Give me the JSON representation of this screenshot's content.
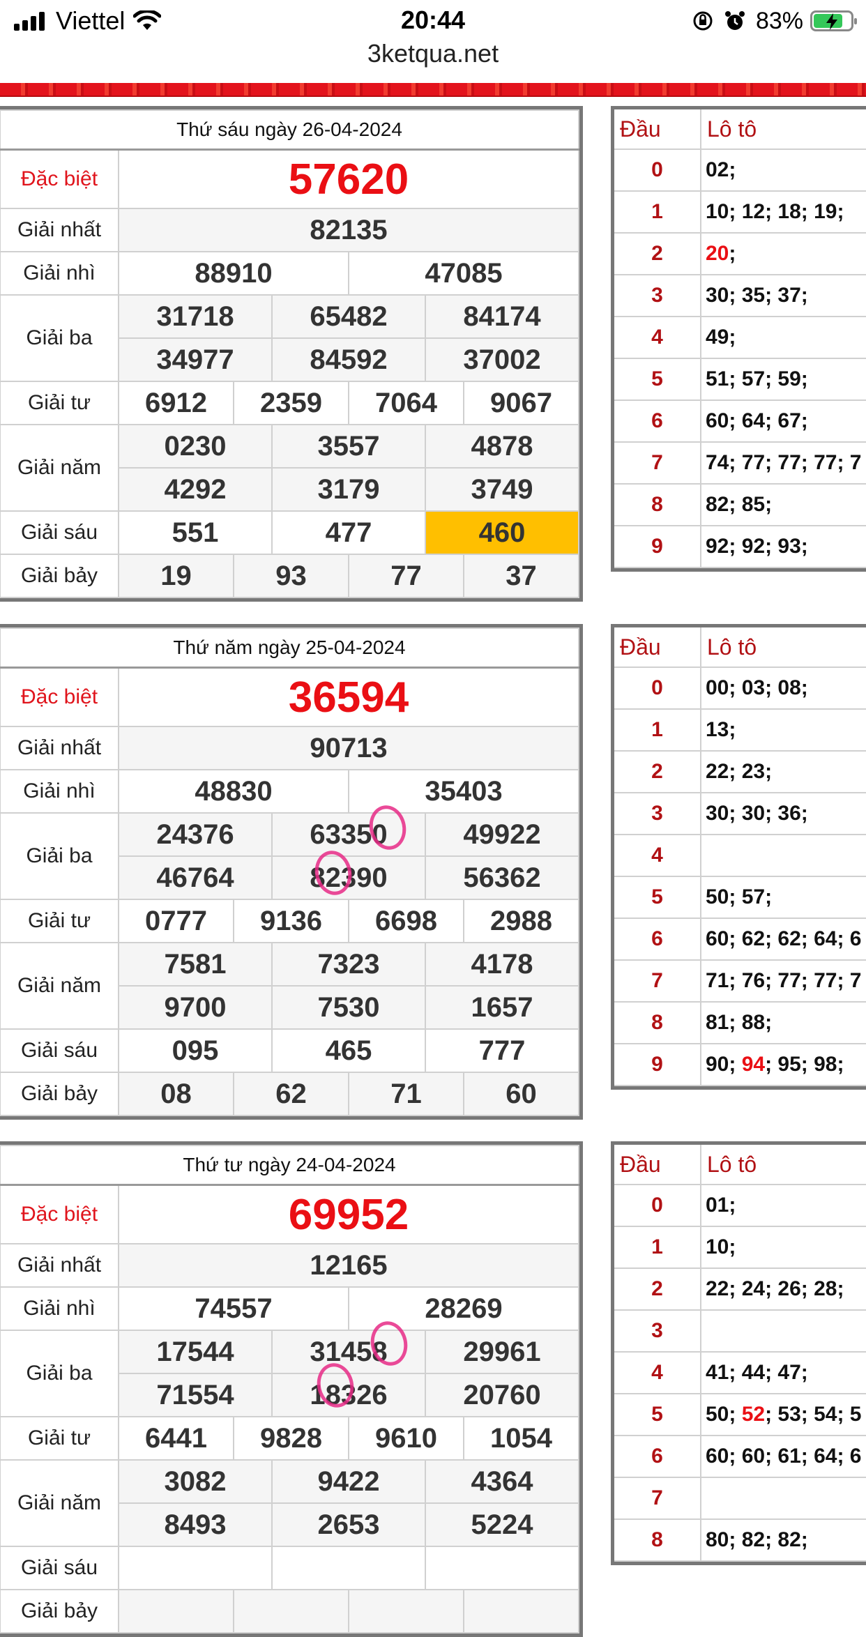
{
  "status": {
    "carrier": "Viettel",
    "time": "20:44",
    "battery": "83%",
    "icons": [
      "signal-icon",
      "wifi-icon",
      "orientation-lock-icon",
      "alarm-icon",
      "battery-charging-icon"
    ]
  },
  "url": "3ketqua.net",
  "days": [
    {
      "date": "Thứ sáu ngày 26-04-2024",
      "labels": {
        "db": "Đặc biệt",
        "g1": "Giải nhất",
        "g2": "Giải nhì",
        "g3": "Giải ba",
        "g4": "Giải tư",
        "g5": "Giải năm",
        "g6": "Giải sáu",
        "g7": "Giải bảy"
      },
      "db": "57620",
      "g1": "82135",
      "g2": [
        "88910",
        "47085"
      ],
      "g3": [
        "31718",
        "65482",
        "84174",
        "34977",
        "84592",
        "37002"
      ],
      "g4": [
        "6912",
        "2359",
        "7064",
        "9067"
      ],
      "g5": [
        "0230",
        "3557",
        "4878",
        "4292",
        "3179",
        "3749"
      ],
      "g6": [
        "551",
        "477",
        "460"
      ],
      "g7": [
        "19",
        "93",
        "77",
        "37"
      ],
      "loto_head": {
        "dau": "Đầu",
        "loto": "Lô tô"
      },
      "loto": [
        {
          "d": "0",
          "pre": "02;",
          "red": "",
          "post": ""
        },
        {
          "d": "1",
          "pre": "10; 12; 18; 19;",
          "red": "",
          "post": ""
        },
        {
          "d": "2",
          "pre": "",
          "red": "20",
          "post": ";"
        },
        {
          "d": "3",
          "pre": "30; 35; 37;",
          "red": "",
          "post": ""
        },
        {
          "d": "4",
          "pre": "49;",
          "red": "",
          "post": ""
        },
        {
          "d": "5",
          "pre": "51; 57; 59;",
          "red": "",
          "post": ""
        },
        {
          "d": "6",
          "pre": "60; 64; 67;",
          "red": "",
          "post": ""
        },
        {
          "d": "7",
          "pre": "74; 77; 77; 77; 7",
          "red": "",
          "post": ""
        },
        {
          "d": "8",
          "pre": "82; 85;",
          "red": "",
          "post": ""
        },
        {
          "d": "9",
          "pre": "92; 92; 93;",
          "red": "",
          "post": ""
        }
      ]
    },
    {
      "date": "Thứ năm ngày 25-04-2024",
      "labels": {
        "db": "Đặc biệt",
        "g1": "Giải nhất",
        "g2": "Giải nhì",
        "g3": "Giải ba",
        "g4": "Giải tư",
        "g5": "Giải năm",
        "g6": "Giải sáu",
        "g7": "Giải bảy"
      },
      "db": "36594",
      "g1": "90713",
      "g2": [
        "48830",
        "35403"
      ],
      "g3": [
        "24376",
        "63350",
        "49922",
        "46764",
        "82390",
        "56362"
      ],
      "g4": [
        "0777",
        "9136",
        "6698",
        "2988"
      ],
      "g5": [
        "7581",
        "7323",
        "4178",
        "9700",
        "7530",
        "1657"
      ],
      "g6": [
        "095",
        "465",
        "777"
      ],
      "g7": [
        "08",
        "62",
        "71",
        "60"
      ],
      "loto_head": {
        "dau": "Đầu",
        "loto": "Lô tô"
      },
      "loto": [
        {
          "d": "0",
          "pre": "00; 03; 08;",
          "red": "",
          "post": ""
        },
        {
          "d": "1",
          "pre": "13;",
          "red": "",
          "post": ""
        },
        {
          "d": "2",
          "pre": "22; 23;",
          "red": "",
          "post": ""
        },
        {
          "d": "3",
          "pre": "30; 30; 36;",
          "red": "",
          "post": ""
        },
        {
          "d": "4",
          "pre": "",
          "red": "",
          "post": ""
        },
        {
          "d": "5",
          "pre": "50; 57;",
          "red": "",
          "post": ""
        },
        {
          "d": "6",
          "pre": "60; 62; 62; 64; 6",
          "red": "",
          "post": ""
        },
        {
          "d": "7",
          "pre": "71; 76; 77; 77; 7",
          "red": "",
          "post": ""
        },
        {
          "d": "8",
          "pre": "81; 88;",
          "red": "",
          "post": ""
        },
        {
          "d": "9",
          "pre": "90; ",
          "red": "94",
          "post": "; 95; 98;"
        }
      ]
    },
    {
      "date": "Thứ tư ngày 24-04-2024",
      "labels": {
        "db": "Đặc biệt",
        "g1": "Giải nhất",
        "g2": "Giải nhì",
        "g3": "Giải ba",
        "g4": "Giải tư",
        "g5": "Giải năm",
        "g6": "Giải sáu",
        "g7": "Giải bảy"
      },
      "db": "69952",
      "g1": "12165",
      "g2": [
        "74557",
        "28269"
      ],
      "g3": [
        "17544",
        "31458",
        "29961",
        "71554",
        "18326",
        "20760"
      ],
      "g4": [
        "6441",
        "9828",
        "9610",
        "1054"
      ],
      "g5": [
        "3082",
        "9422",
        "4364",
        "8493",
        "2653",
        "5224"
      ],
      "g6": [
        "",
        "",
        ""
      ],
      "g7": [
        "",
        "",
        "",
        ""
      ],
      "loto_head": {
        "dau": "Đầu",
        "loto": "Lô tô"
      },
      "loto": [
        {
          "d": "0",
          "pre": "01;",
          "red": "",
          "post": ""
        },
        {
          "d": "1",
          "pre": "10;",
          "red": "",
          "post": ""
        },
        {
          "d": "2",
          "pre": "22; 24; 26; 28;",
          "red": "",
          "post": ""
        },
        {
          "d": "3",
          "pre": "",
          "red": "",
          "post": ""
        },
        {
          "d": "4",
          "pre": "41; 44; 47;",
          "red": "",
          "post": ""
        },
        {
          "d": "5",
          "pre": "50; ",
          "red": "52",
          "post": "; 53; 54; 5"
        },
        {
          "d": "6",
          "pre": "60; 60; 61; 64; 6",
          "red": "",
          "post": ""
        },
        {
          "d": "7",
          "pre": "",
          "red": "",
          "post": ""
        },
        {
          "d": "8",
          "pre": "80; 82; 82;",
          "red": "",
          "post": ""
        }
      ]
    }
  ]
}
